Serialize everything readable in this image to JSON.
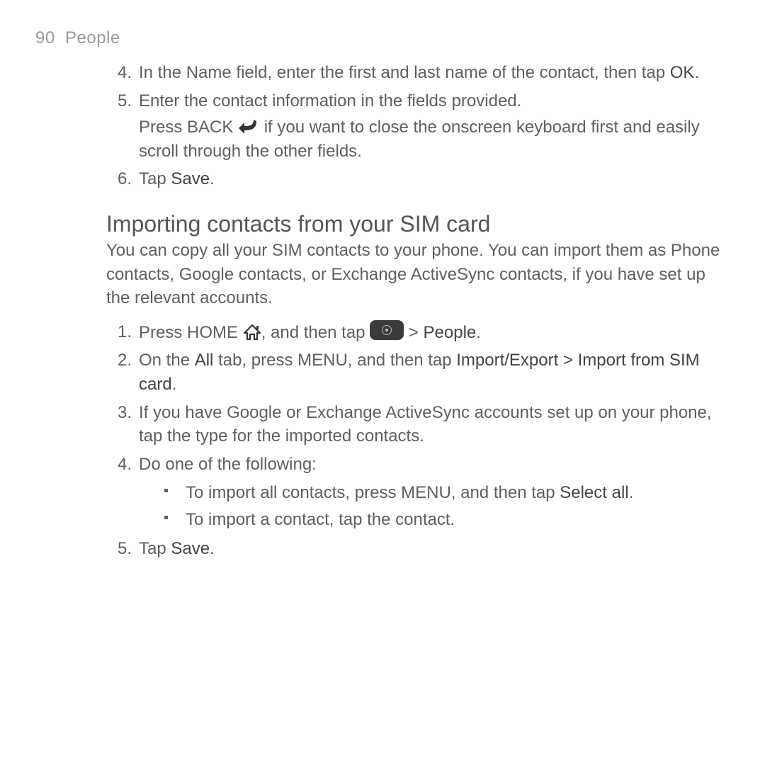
{
  "header": {
    "page_num": "90",
    "section": "People"
  },
  "top_steps": [
    {
      "num": "4.",
      "text_before": "In the Name field, enter the first and last name of the contact, then tap ",
      "bold": "OK",
      "text_after": "."
    },
    {
      "num": "5.",
      "text_before": "Enter the contact information in the fields provided.",
      "sub_before": "Press BACK ",
      "sub_after": " if you want to close the onscreen keyboard first and easily scroll through the other fields."
    },
    {
      "num": "6.",
      "text_before": "Tap ",
      "bold": "Save",
      "text_after": "."
    }
  ],
  "section_heading": "Importing contacts from your SIM card",
  "intro": "You can copy all your SIM contacts to your phone. You can import them as Phone contacts, Google contacts, or Exchange ActiveSync contacts, if you have set up the relevant accounts.",
  "steps": [
    {
      "num": "1.",
      "p1": "Press HOME ",
      "p2": ", and then tap ",
      "p3": " > ",
      "bold1": "People",
      "p4": "."
    },
    {
      "num": "2.",
      "p1": "On the ",
      "bold1": "All",
      "p2": " tab, press MENU, and then tap ",
      "bold2": "Import/Export > Import from SIM card",
      "p3": "."
    },
    {
      "num": "3.",
      "p1": "If you have Google or Exchange ActiveSync accounts set up on your phone, tap the type for the imported contacts."
    },
    {
      "num": "4.",
      "p1": "Do one of the following:",
      "bullets": [
        {
          "t1": "To import all contacts, press MENU, and then tap ",
          "bold": "Select all",
          "t2": "."
        },
        {
          "t1": "To import a contact, tap the contact."
        }
      ]
    },
    {
      "num": "5.",
      "p1": "Tap ",
      "bold1": "Save",
      "p2": "."
    }
  ]
}
